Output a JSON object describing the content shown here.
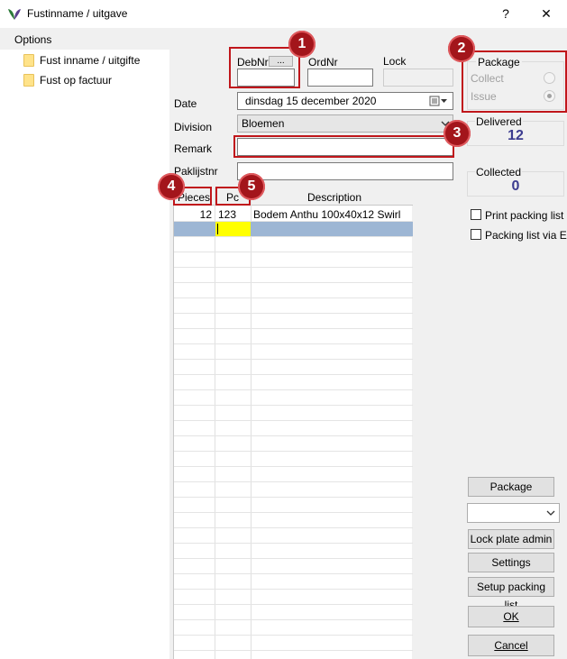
{
  "window": {
    "title": "Fustinname / uitgave",
    "help_label": "?",
    "close_label": "✕",
    "icon": "leaf-logo-icon"
  },
  "sidebar": {
    "options_label": "Options",
    "items": [
      {
        "label": "Fust inname / uitgifte",
        "icon": "folder-icon"
      },
      {
        "label": "Fust op factuur",
        "icon": "folder-icon"
      }
    ]
  },
  "form": {
    "debnr_label": "DebNr",
    "debnr_button": "...",
    "debnr_value": "",
    "ordnr_label": "OrdNr",
    "ordnr_value": "",
    "lock_label": "Lock",
    "lock_value": "",
    "date_label": "Date",
    "date_value": "dinsdag   15 december 2020",
    "division_label": "Division",
    "division_value": "Bloemen",
    "remark_label": "Remark",
    "remark_value": "",
    "paklijstnr_label": "Paklijstnr",
    "paklijstnr_value": ""
  },
  "package_group": {
    "title": "Package",
    "collect_label": "Collect",
    "issue_label": "Issue",
    "selected": "Issue"
  },
  "counters": {
    "delivered_label": "Delivered",
    "delivered_value": "12",
    "collected_label": "Collected",
    "collected_value": "0"
  },
  "checkboxes": {
    "print_packing_list": "Print packing list",
    "packing_list_email": "Packing list via E-m"
  },
  "grid": {
    "headers": [
      "Pieces",
      "Pc",
      "Description"
    ],
    "rows": [
      {
        "pieces": "12",
        "pc": "123",
        "description": "Bodem Anthu 100x40x12 Swirl"
      }
    ]
  },
  "buttons": {
    "package": "Package",
    "dropdown_value": "",
    "lock_plate_admin": "Lock plate admin",
    "settings": "Settings",
    "setup_packing_list": "Setup packing list",
    "ok": "OK",
    "cancel": "Cancel"
  },
  "annotations": [
    "1",
    "2",
    "3",
    "4",
    "5"
  ],
  "colors": {
    "annotation_red": "#c0161b",
    "counter_blue": "#3b3b8f",
    "selected_row": "#9db6d4",
    "active_cell": "#ffff00"
  }
}
